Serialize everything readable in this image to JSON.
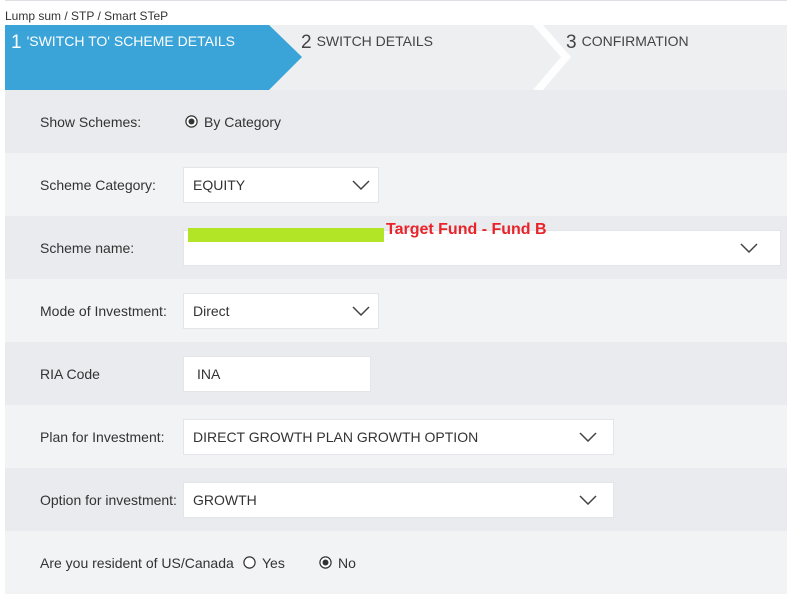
{
  "breadcrumb": "Lump sum / STP / Smart STeP",
  "steps": [
    {
      "num": "1",
      "label": "'SWITCH TO' SCHEME DETAILS",
      "active": true
    },
    {
      "num": "2",
      "label": "SWITCH DETAILS",
      "active": false
    },
    {
      "num": "3",
      "label": "CONFIRMATION",
      "active": false
    }
  ],
  "colors": {
    "active_step": "#3aa4d9",
    "row_dark": "#e9ebee",
    "row_light": "#f2f3f5",
    "highlight": "#b2e526",
    "annotation": "#e8232a"
  },
  "form": {
    "show_schemes": {
      "label": "Show Schemes:",
      "option": "By Category"
    },
    "scheme_category": {
      "label": "Scheme Category:",
      "value": "EQUITY"
    },
    "scheme_name": {
      "label": "Scheme name:",
      "value": ""
    },
    "mode_of_investment": {
      "label": "Mode of Investment:",
      "value": "Direct"
    },
    "ria_code": {
      "label": "RIA Code",
      "value": "INA"
    },
    "plan": {
      "label": "Plan for Investment:",
      "value": "DIRECT GROWTH PLAN GROWTH OPTION"
    },
    "option": {
      "label": "Option for investment:",
      "value": "GROWTH"
    },
    "resident": {
      "label": "Are you resident of US/Canada",
      "yes": "Yes",
      "no": "No",
      "selected": "No"
    }
  },
  "annotation": "Target Fund - Fund B",
  "icons": {
    "dropdown": "chevron-down-icon",
    "radio_on": "radio-selected-icon",
    "radio_off": "radio-unselected-icon"
  }
}
